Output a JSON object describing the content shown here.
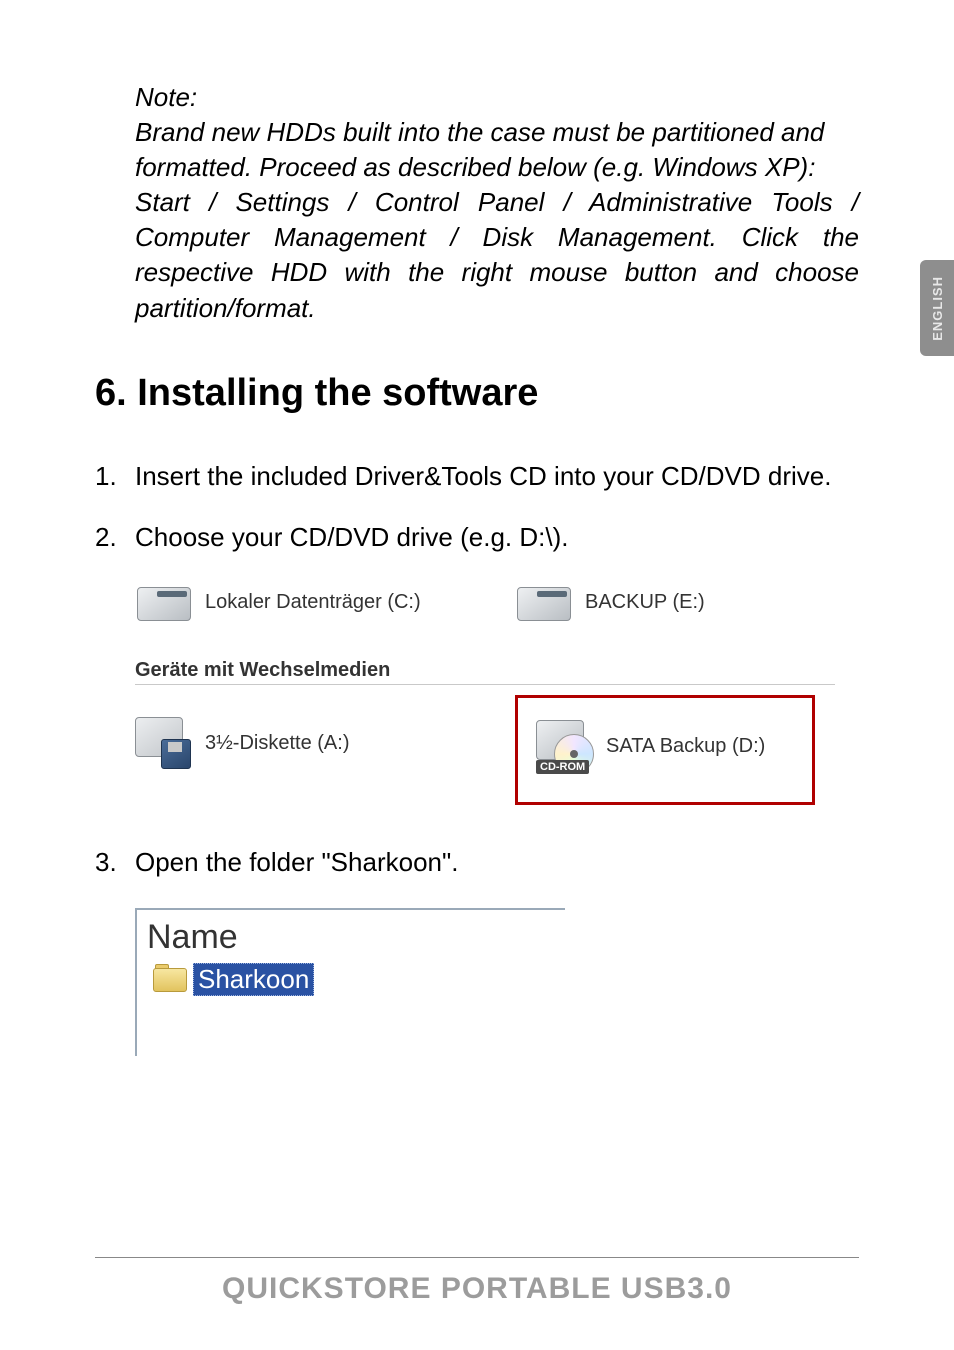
{
  "side_tab": "ENGLISH",
  "note": {
    "label": "Note:",
    "line1": "Brand new HDDs built into the case must be partitioned and formatted. Proceed as described below (e.g. Windows XP):",
    "line2": "Start / Settings / Control Panel / Administrative Tools / Computer Management / Disk Management. Click the respective HDD with the right mouse button and choose partition/format."
  },
  "heading": "6. Installing the software",
  "steps": {
    "s1": {
      "num": "1.",
      "text": "Insert the included Driver&Tools CD into your CD/DVD drive."
    },
    "s2": {
      "num": "2.",
      "text": "Choose your CD/DVD drive (e.g. D:\\)."
    },
    "s3": {
      "num": "3.",
      "text": "Open the folder \"Sharkoon\"."
    }
  },
  "drives_figure": {
    "local_c": "Lokaler Datenträger (C:)",
    "backup_e": "BACKUP (E:)",
    "section_label": "Geräte mit Wechselmedien",
    "floppy_a": "3½-Diskette (A:)",
    "cd_badge": "CD-ROM",
    "sata_d": "SATA Backup (D:)"
  },
  "folder_figure": {
    "column_header": "Name",
    "folder_name": "Sharkoon"
  },
  "footer": "QUICKSTORE PORTABLE USB3.0"
}
